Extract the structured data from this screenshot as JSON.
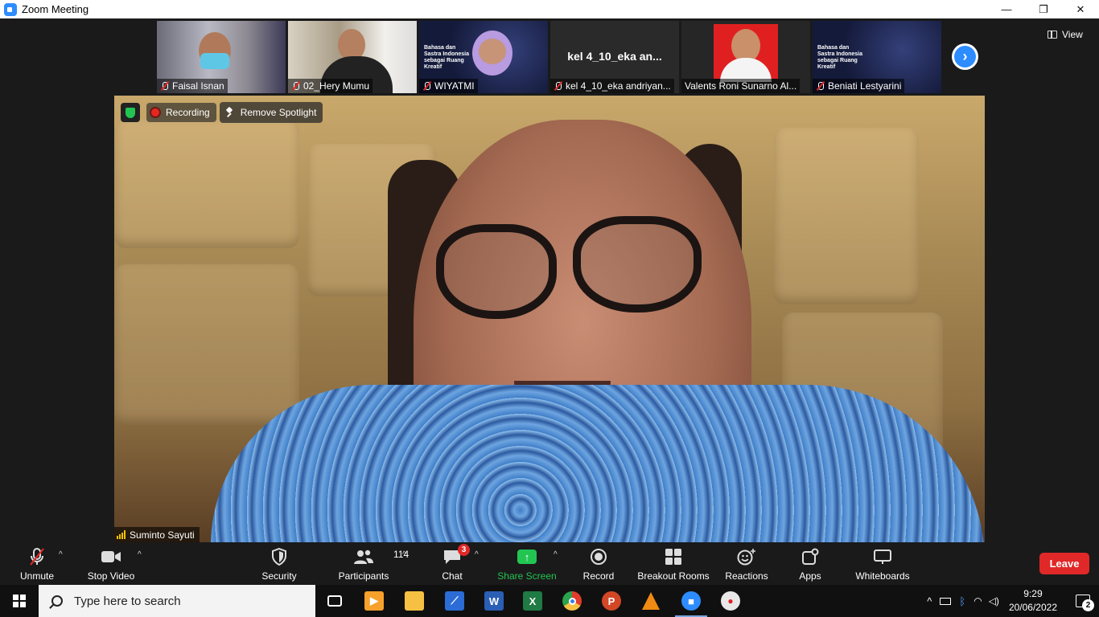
{
  "window": {
    "title": "Zoom Meeting",
    "controls": [
      "—",
      "❐",
      "✕"
    ]
  },
  "thumbnails": [
    {
      "name": "Faisal Isnan",
      "muted": true
    },
    {
      "name": "02_Hery Mumu",
      "muted": true
    },
    {
      "name": "WIYATMI",
      "muted": true,
      "slide_text": "Bahasa dan Sastra Indonesia sebagai Ruang Kreatif"
    },
    {
      "name": "kel 4_10_eka andriyan...",
      "muted": true,
      "center_name": "kel 4_10_eka an..."
    },
    {
      "name": "Valents Roni Sunarno Al...",
      "muted": false
    },
    {
      "name": "Beniati Lestyarini",
      "muted": true,
      "slide_text": "Bahasa dan Sastra Indonesia sebagai Ruang Kreatif"
    }
  ],
  "view_button": "View",
  "main_video": {
    "badges": {
      "recording": "Recording",
      "remove_spotlight": "Remove Spotlight"
    },
    "speaker_name": "Suminto Sayuti"
  },
  "toolbar": {
    "unmute": "Unmute",
    "stop_video": "Stop Video",
    "security": "Security",
    "participants": "Participants",
    "participants_count": "114",
    "chat": "Chat",
    "chat_badge": "3",
    "share_screen": "Share Screen",
    "record": "Record",
    "breakout_rooms": "Breakout Rooms",
    "reactions": "Reactions",
    "apps": "Apps",
    "whiteboards": "Whiteboards",
    "leave": "Leave"
  },
  "taskbar": {
    "search_placeholder": "Type here to search",
    "time": "9:29",
    "date": "20/06/2022",
    "notification_count": "2"
  },
  "colors": {
    "accent": "#2d8cff",
    "leave": "#e02828",
    "share": "#23c552",
    "recording": "#e8261f"
  }
}
